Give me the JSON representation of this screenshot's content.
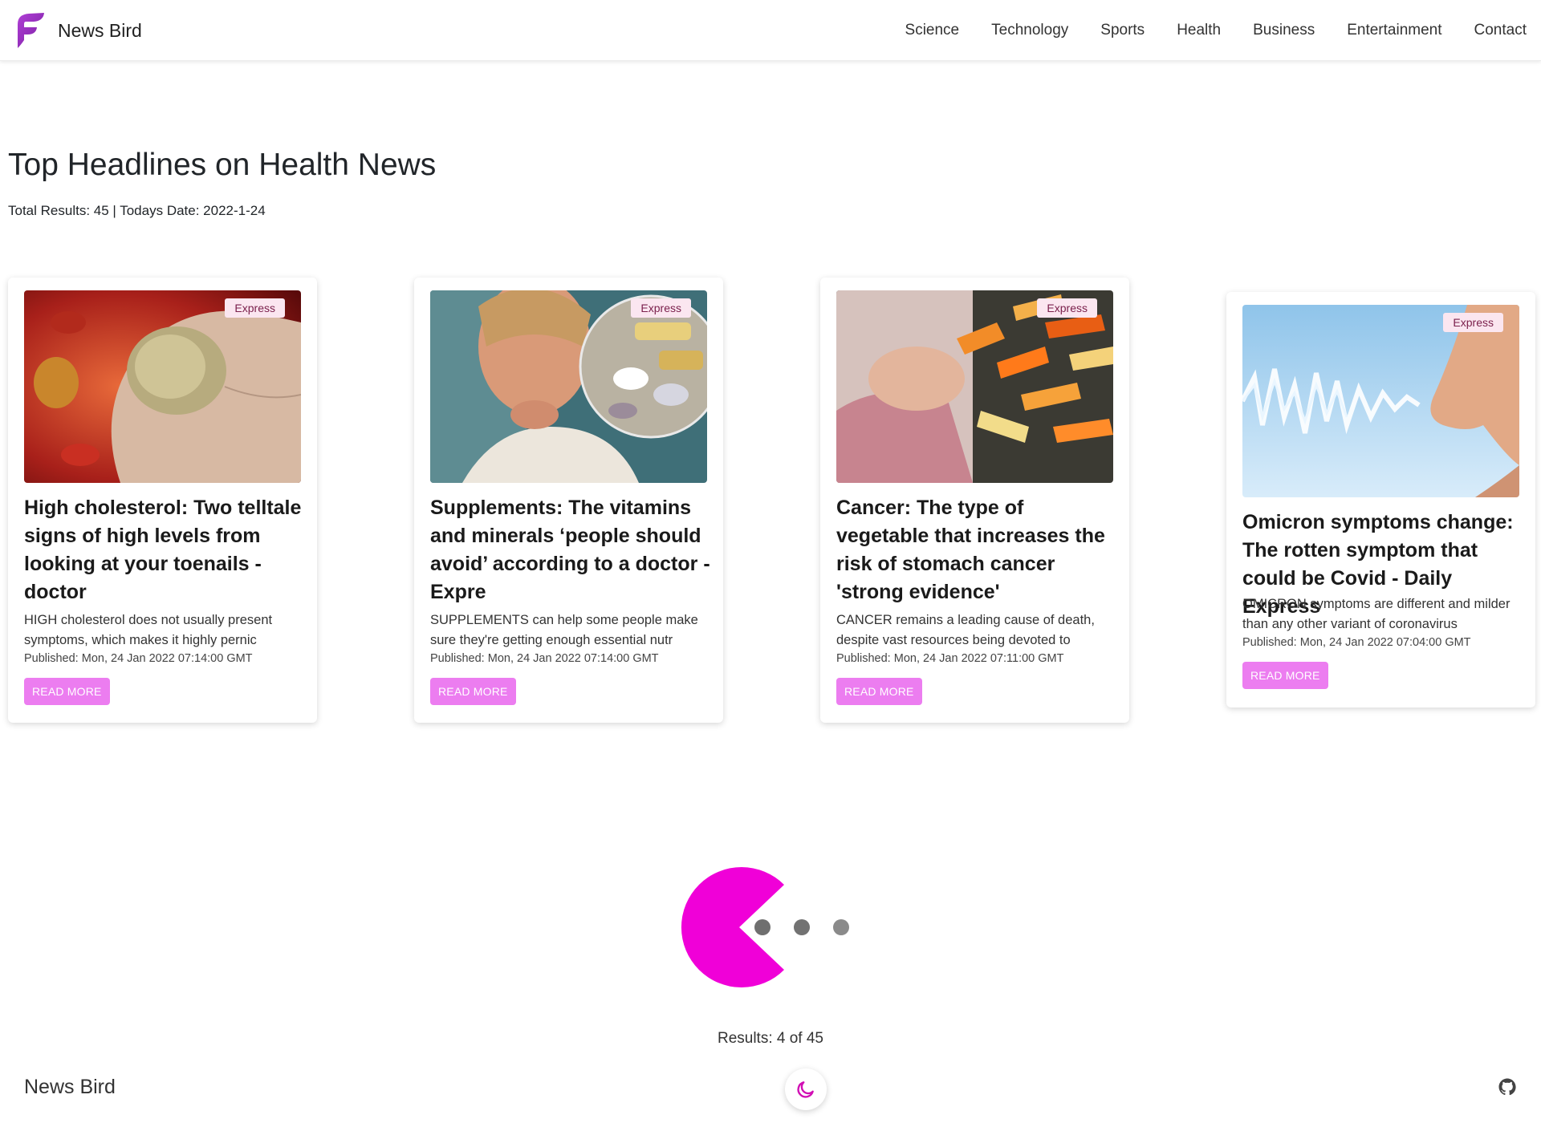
{
  "brand": {
    "name": "News Bird",
    "logo_icon": "feather-logo-icon",
    "accent": "#8e24aa"
  },
  "nav": {
    "links": [
      "Science",
      "Technology",
      "Sports",
      "Health",
      "Business",
      "Entertainment",
      "Contact"
    ]
  },
  "header": {
    "title": "Top Headlines on Health News",
    "meta": "Total Results: 45 | Todays Date: 2022-1-24"
  },
  "cards": [
    {
      "source": "Express",
      "title": "High cholesterol: Two telltale signs of high levels from looking at your toenails - doctor",
      "description": "HIGH cholesterol does not usually present symptoms, which makes it highly pernic",
      "published": "Published: Mon, 24 Jan 2022 07:14:00 GMT",
      "button": "READ MORE"
    },
    {
      "source": "Express",
      "title": "Supplements: The vitamins and minerals ‘people should avoid’ according to a doctor - Expre",
      "description": "SUPPLEMENTS can help some people make sure they're getting enough essential nutr",
      "published": "Published: Mon, 24 Jan 2022 07:14:00 GMT",
      "button": "READ MORE"
    },
    {
      "source": "Express",
      "title": "Cancer: The type of vegetable that increases the risk of stomach cancer 'strong evidence'",
      "description": "CANCER remains a leading cause of death, despite vast resources being devoted to",
      "published": "Published: Mon, 24 Jan 2022 07:11:00 GMT",
      "button": "READ MORE"
    },
    {
      "source": "Express",
      "title": "Omicron symptoms change: The rotten symptom that could be Covid - Daily Express",
      "description": "OMICRON symptoms are different and milder than any other variant of coronavirus",
      "published": "Published: Mon, 24 Jan 2022 07:04:00 GMT",
      "button": "READ MORE"
    }
  ],
  "loader": {
    "type": "pacman-loader",
    "color": "#f000d8",
    "dot_color": "#757575"
  },
  "pagination": {
    "results_text": "Results: 4 of 45"
  },
  "footer": {
    "brand": "News Bird",
    "theme_icon": "moon-icon",
    "github_icon": "github-icon"
  },
  "colors": {
    "button_bg": "#ec7df0",
    "badge_bg": "#fbe6f0",
    "badge_text": "#7a1f4b"
  }
}
